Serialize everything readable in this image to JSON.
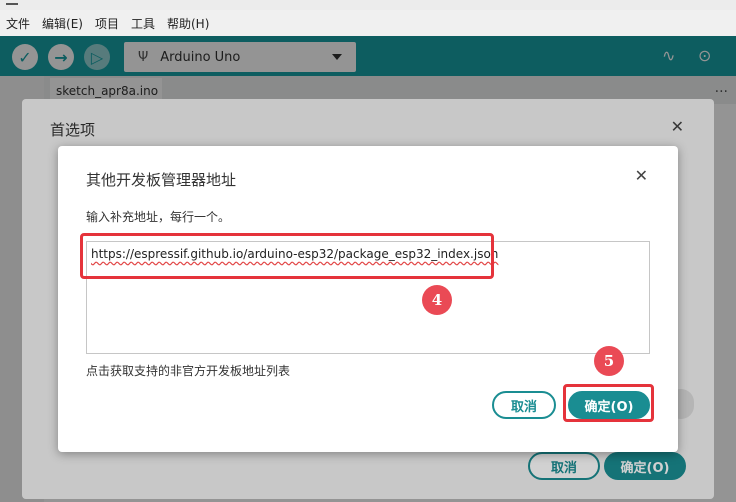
{
  "menubar": {
    "items": [
      "文件",
      "编辑(E)",
      "项目",
      "工具",
      "帮助(H)"
    ]
  },
  "toolbar": {
    "board": "Arduino Uno",
    "icons": [
      "verify-icon",
      "upload-icon",
      "debug-icon",
      "usb-icon",
      "serial-plotter-icon",
      "serial-monitor-icon"
    ],
    "accent": "#17a1a5"
  },
  "editor": {
    "tab_label": "sketch_apr8a.ino",
    "more": "..."
  },
  "preferences": {
    "title": "首选项",
    "cancel_label": "取消",
    "ok_label": "确定(O)"
  },
  "urls_dialog": {
    "title": "其他开发板管理器地址",
    "prompt": "输入补充地址，每行一个。",
    "url_value": "https://espressif.github.io/arduino-esp32/package_esp32_index.json",
    "link_text": "点击获取支持的非官方开发板地址列表",
    "cancel_label": "取消",
    "ok_label": "确定(O)"
  },
  "annotations": {
    "step4": "4",
    "step5": "5",
    "color": "#e5333b"
  }
}
